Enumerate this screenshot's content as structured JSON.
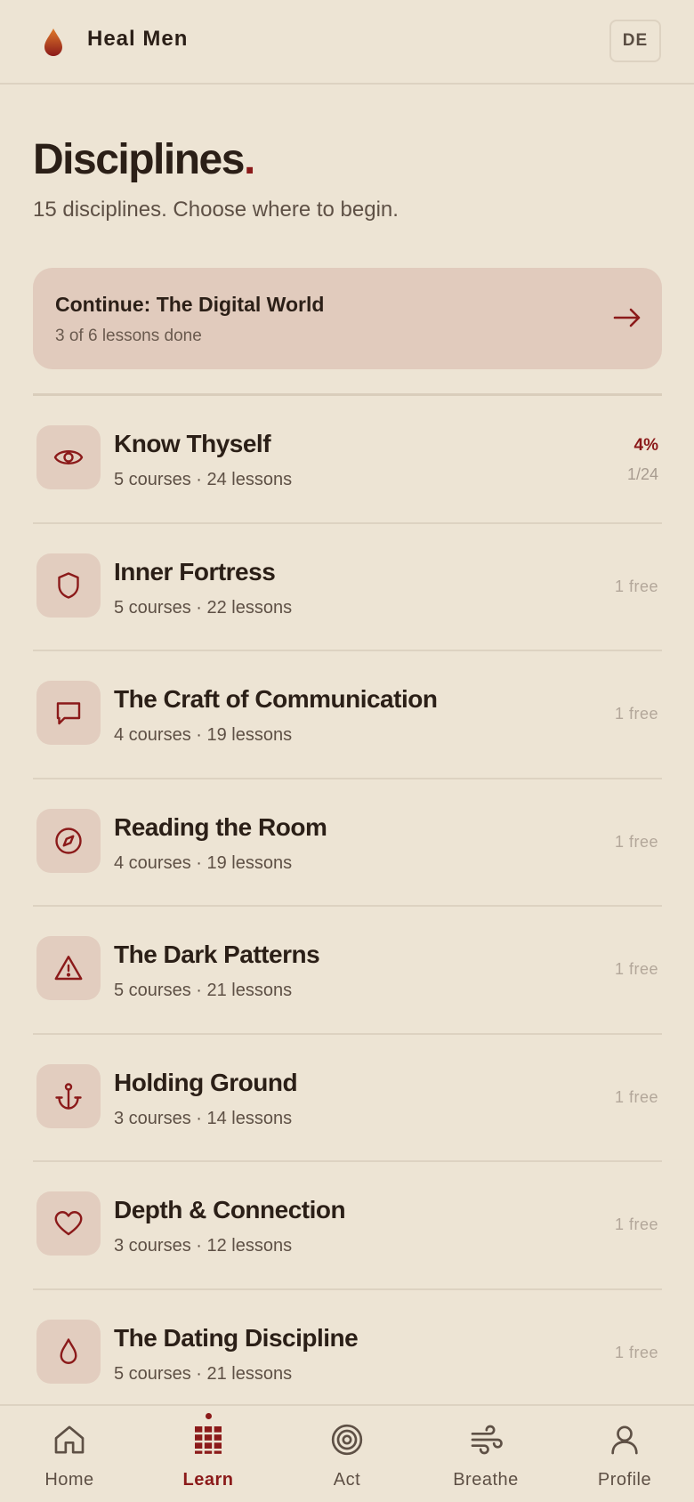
{
  "header": {
    "brand": "Heal Men",
    "lang": "DE",
    "logo_icon": "flame-drop-icon"
  },
  "page": {
    "title": "Disciplines",
    "title_dot": ".",
    "subtitle": "15 disciplines. Choose where to begin."
  },
  "continue": {
    "title": "Continue: The Digital World",
    "subtitle": "3 of 6 lessons done",
    "arrow_icon": "arrow-right-icon"
  },
  "disciplines": [
    {
      "icon": "eye-icon",
      "title": "Know Thyself",
      "meta": "5 courses · 24 lessons",
      "progress": "4%",
      "count": "1/24",
      "badge": ""
    },
    {
      "icon": "shield-icon",
      "title": "Inner Fortress",
      "meta": "5 courses · 22 lessons",
      "progress": "",
      "count": "",
      "badge": "1 free"
    },
    {
      "icon": "chat-bubble-icon",
      "title": "The Craft of Communication",
      "meta": "4 courses · 19 lessons",
      "progress": "",
      "count": "",
      "badge": "1 free"
    },
    {
      "icon": "compass-icon",
      "title": "Reading the Room",
      "meta": "4 courses · 19 lessons",
      "progress": "",
      "count": "",
      "badge": "1 free"
    },
    {
      "icon": "warning-triangle-icon",
      "title": "The Dark Patterns",
      "meta": "5 courses · 21 lessons",
      "progress": "",
      "count": "",
      "badge": "1 free"
    },
    {
      "icon": "anchor-icon",
      "title": "Holding Ground",
      "meta": "3 courses · 14 lessons",
      "progress": "",
      "count": "",
      "badge": "1 free"
    },
    {
      "icon": "heart-icon",
      "title": "Depth & Connection",
      "meta": "3 courses · 12 lessons",
      "progress": "",
      "count": "",
      "badge": "1 free"
    },
    {
      "icon": "droplet-icon",
      "title": "The Dating Discipline",
      "meta": "5 courses · 21 lessons",
      "progress": "",
      "count": "",
      "badge": "1 free"
    }
  ],
  "tabs": [
    {
      "label": "Home",
      "icon": "home-icon",
      "active": false
    },
    {
      "label": "Learn",
      "icon": "grid-icon",
      "active": true
    },
    {
      "label": "Act",
      "icon": "target-icon",
      "active": false
    },
    {
      "label": "Breathe",
      "icon": "wind-icon",
      "active": false
    },
    {
      "label": "Profile",
      "icon": "user-icon",
      "active": false
    }
  ],
  "colors": {
    "background": "#ede4d4",
    "accent": "#8b1a1a",
    "card": "#e1cbbd",
    "text": "#2b1f17",
    "muted": "#5e5045"
  }
}
